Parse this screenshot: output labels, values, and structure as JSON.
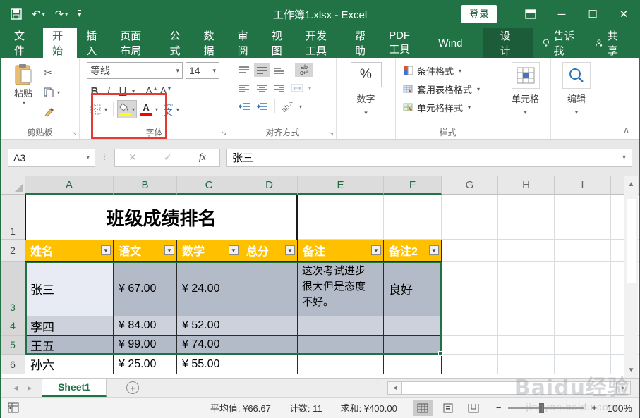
{
  "titlebar": {
    "title": "工作簿1.xlsx - Excel",
    "login": "登录"
  },
  "tabs": {
    "file": "文件",
    "items": [
      "开始",
      "插入",
      "页面布局",
      "公式",
      "数据",
      "审阅",
      "视图",
      "开发工具",
      "帮助",
      "PDF工具",
      "Wind",
      "设计"
    ],
    "tell_me": "告诉我",
    "share": "共享"
  },
  "ribbon": {
    "clipboard": {
      "paste": "粘贴",
      "label": "剪贴板"
    },
    "font": {
      "name": "等线",
      "size": "14",
      "bold": "B",
      "italic": "I",
      "underline": "U",
      "color_letter": "A",
      "phonetic": "文",
      "phonetic_top": "wén",
      "label": "字体"
    },
    "alignment": {
      "wrap_hint": "ab",
      "orient_hint": "ab",
      "label": "对齐方式"
    },
    "number": {
      "percent": "%",
      "label": "数字"
    },
    "styles": {
      "conditional": "条件格式",
      "format_table": "套用表格格式",
      "cell_styles": "单元格样式",
      "label": "样式"
    },
    "cells": {
      "label": "单元格"
    },
    "editing": {
      "label": "编辑"
    }
  },
  "formula": {
    "name_box": "A3",
    "fx": "fx",
    "value": "张三"
  },
  "sheet": {
    "columns": [
      "A",
      "B",
      "C",
      "D",
      "E",
      "F",
      "G",
      "H",
      "I"
    ],
    "row_numbers": [
      "1",
      "2",
      "3",
      "4",
      "5",
      "6"
    ],
    "title": "班级成绩排名",
    "headers": [
      "姓名",
      "语文",
      "数学",
      "总分",
      "备注",
      "备注2"
    ],
    "rows": [
      [
        "张三",
        "¥ 67.00",
        "¥ 24.00",
        "",
        "这次考试进步很大但是态度不好。",
        "良好"
      ],
      [
        "李四",
        "¥ 84.00",
        "¥ 52.00",
        "",
        "",
        ""
      ],
      [
        "王五",
        "¥ 99.00",
        "¥ 74.00",
        "",
        "",
        ""
      ],
      [
        "孙六",
        "¥ 25.00",
        "¥ 55.00",
        "",
        "",
        ""
      ]
    ],
    "active_cell": "A3"
  },
  "sheetbar": {
    "tab": "Sheet1"
  },
  "statusbar": {
    "average": "平均值: ¥66.67",
    "count": "计数: 11",
    "sum": "求和: ¥400.00",
    "zoom": "100%"
  },
  "watermark": {
    "line1": "Baidu经验",
    "line2": "jingyan.baidu.com"
  },
  "colors": {
    "excel_green": "#217346",
    "contextual_tab_green": "#1d5c38",
    "header_gold": "#FFC000",
    "red_callout": "#E23B32",
    "selection_dark": "#B3BAC8",
    "selection_light": "#CDD1DB",
    "active_cell": "#E9EBF4"
  }
}
